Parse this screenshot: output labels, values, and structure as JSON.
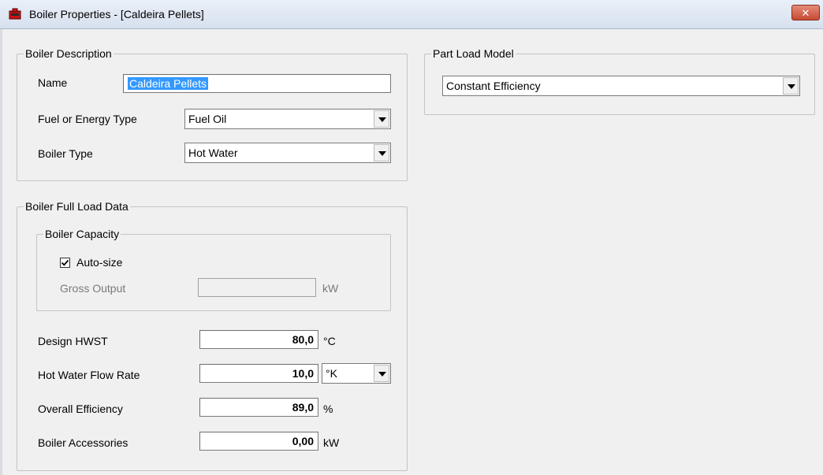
{
  "window": {
    "title": "Boiler Properties - [Caldeira Pellets]",
    "close_glyph": "✕"
  },
  "boiler_description": {
    "legend": "Boiler Description",
    "name_label": "Name",
    "name_value": "Caldeira Pellets",
    "fuel_label": "Fuel or Energy Type",
    "fuel_value": "Fuel Oil",
    "type_label": "Boiler Type",
    "type_value": "Hot Water"
  },
  "part_load_model": {
    "legend": "Part Load Model",
    "value": "Constant Efficiency"
  },
  "full_load_data": {
    "legend": "Boiler Full Load Data",
    "capacity": {
      "legend": "Boiler Capacity",
      "autosize_label": "Auto-size",
      "autosize_checked": true,
      "gross_output_label": "Gross Output",
      "gross_output_value": "",
      "gross_output_unit": "kW"
    },
    "design_hwst_label": "Design HWST",
    "design_hwst_value": "80,0",
    "design_hwst_unit": "°C",
    "flow_rate_label": "Hot Water Flow Rate",
    "flow_rate_value": "10,0",
    "flow_rate_unit": "°K",
    "efficiency_label": "Overall Efficiency",
    "efficiency_value": "89,0",
    "efficiency_unit": "%",
    "accessories_label": "Boiler Accessories",
    "accessories_value": "0,00",
    "accessories_unit": "kW"
  },
  "icons": {
    "app": "boiler-app-icon",
    "close": "close-icon",
    "dropdown": "chevron-down-icon",
    "check": "checkmark-icon"
  },
  "colors": {
    "selection": "#3399ff",
    "close_button": "#c74a33",
    "window_bg": "#f0f0f0"
  }
}
